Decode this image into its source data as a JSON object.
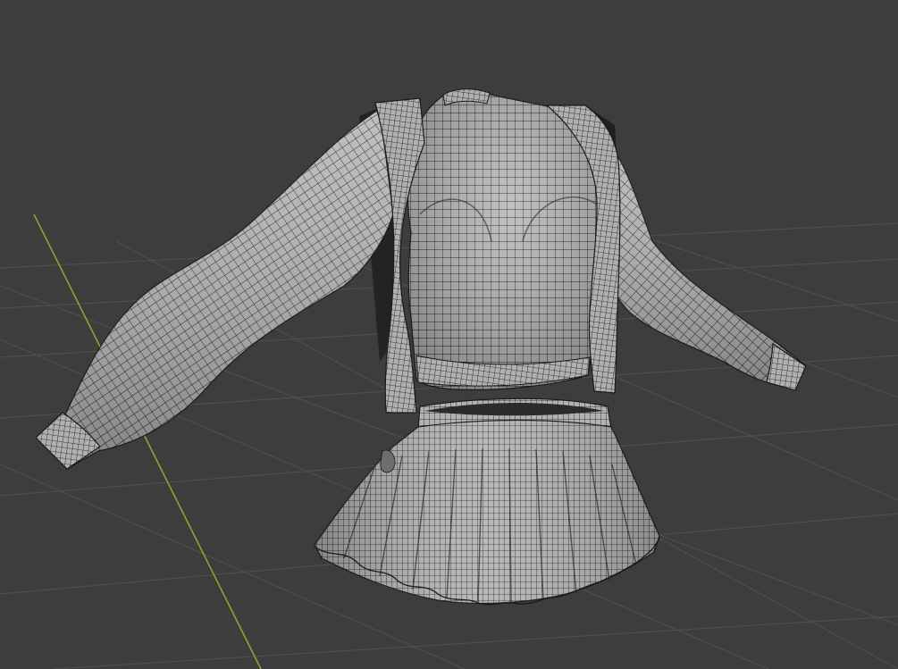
{
  "viewport": {
    "mode": "3d-viewport-wireframe-overlay",
    "background_color": "#3d3d3d",
    "grid_line_color": "#4e4e4e",
    "y_axis_color": "#85a63a",
    "mesh_fill_color": "#a8a8a8",
    "mesh_wire_color": "#1a1a1a",
    "mesh_shadow_color": "#6e6e6e"
  },
  "model": {
    "icon": "clothing-mesh-icon",
    "parts": [
      "sweater-torso",
      "jacket-left-panel",
      "jacket-right-panel",
      "left-sleeve",
      "right-sleeve",
      "pleated-skirt"
    ]
  }
}
